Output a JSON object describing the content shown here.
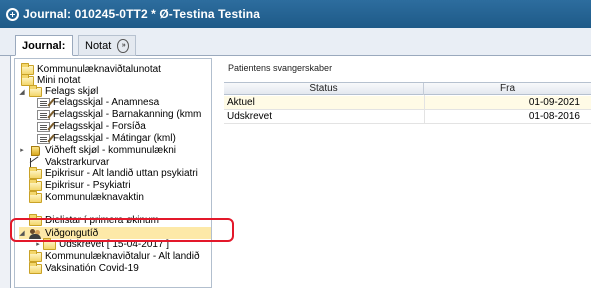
{
  "window": {
    "title": "Journal: 010245-0TT2 * Ø-Testina Testina"
  },
  "tabs": [
    {
      "label": "Journal:",
      "active": true
    },
    {
      "label": "Notat",
      "badge": "»"
    }
  ],
  "tree": {
    "items": [
      {
        "label": "Kommunulæknaviðtalunotat",
        "icon": "folder-icon",
        "level": 0
      },
      {
        "label": "Mini notat",
        "icon": "folder-icon",
        "level": 0
      },
      {
        "label": "Felags skjøl",
        "icon": "folder-icon",
        "level": 0,
        "expanded": true
      },
      {
        "label": "Felagsskjal - Anamnesa",
        "icon": "form-icon",
        "level": 1
      },
      {
        "label": "Felagsskjal - Barnakanning (kmm",
        "icon": "form-icon",
        "level": 1
      },
      {
        "label": "Felagsskjal - Forsíða",
        "icon": "form-icon",
        "level": 1
      },
      {
        "label": "Felagsskjal - Mátingar (kml)",
        "icon": "form-icon",
        "level": 1
      },
      {
        "label": "Viðheft skjøl - kommunulækni",
        "icon": "sheet-icon",
        "level": 0,
        "collapsed": true
      },
      {
        "label": "Vakstrarkurvar",
        "icon": "chart-icon",
        "level": 0
      },
      {
        "label": "Epikrisur - Alt landið uttan psykiatri",
        "icon": "folder-icon",
        "level": 0
      },
      {
        "label": "Epikrisur - Psykiatri",
        "icon": "folder-icon",
        "level": 0
      },
      {
        "label": "Kommunulæknavaktin",
        "icon": "folder-icon",
        "level": 0
      },
      {
        "label": "Dielistar í primera økinum",
        "icon": "folder-icon",
        "level": 0
      },
      {
        "label": "Viðgongutíð",
        "icon": "people-icon",
        "level": 0,
        "expanded": true,
        "selected": true
      },
      {
        "label": "Udskrevet [ 15-04-2017 ]",
        "icon": "folder-icon",
        "level": 1,
        "collapsed": true
      },
      {
        "label": "Kommunulæknaviðtalur - Alt landið",
        "icon": "folder-icon",
        "level": 0
      },
      {
        "label": "Vaksinatión Covid-19",
        "icon": "folder-icon",
        "level": 0
      }
    ]
  },
  "grid": {
    "caption": "Patientens svangerskaber",
    "columns": [
      "Status",
      "Fra"
    ],
    "rows": [
      {
        "status": "Aktuel",
        "fra": "01-09-2021"
      },
      {
        "status": "Udskrevet",
        "fra": "01-08-2016"
      }
    ]
  },
  "colors": {
    "title_bar": "#1e5a88",
    "selection": "#fde9a8",
    "highlight_border": "#e3182a"
  }
}
